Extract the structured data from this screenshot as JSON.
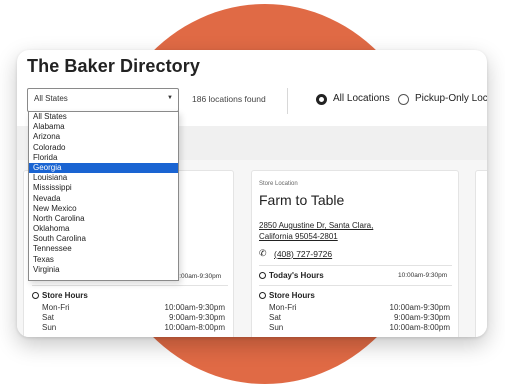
{
  "page_title": "The Baker Directory",
  "state_select": {
    "value": "All States",
    "options": [
      "All States",
      "Alabama",
      "Arizona",
      "Colorado",
      "Florida",
      "Georgia",
      "Louisiana",
      "Mississippi",
      "Nevada",
      "New Mexico",
      "North Carolina",
      "Oklahoma",
      "South Carolina",
      "Tennessee",
      "Texas",
      "Virginia"
    ],
    "highlighted": "Georgia"
  },
  "locations_found": "186 locations found",
  "filter": {
    "all_label": "All Locations",
    "pickup_label": "Pickup-Only Loca",
    "selected": "All Locations"
  },
  "stores": [
    {
      "todays_hours_value": "10:00am-9:30pm",
      "hours": [
        {
          "day": "Mon-Fri",
          "time": "10:00am-9:30pm"
        },
        {
          "day": "Sat",
          "time": "9:00am-9:30pm"
        },
        {
          "day": "Sun",
          "time": "10:00am-8:00pm"
        }
      ]
    },
    {
      "label": "Store Location",
      "name": "Farm to Table",
      "address_line1": "2850 Augustine Dr, Santa Clara,",
      "address_line2": "California 95054-2801",
      "phone": "(408) 727-9726",
      "todays_hours_label": "Today's Hours",
      "todays_hours_value": "10:00am-9:30pm",
      "hours": [
        {
          "day": "Mon-Fri",
          "time": "10:00am-9:30pm"
        },
        {
          "day": "Sat",
          "time": "9:00am-9:30pm"
        },
        {
          "day": "Sun",
          "time": "10:00am-8:00pm"
        }
      ]
    }
  ],
  "store_hours_label": "Store Hours",
  "icons": {
    "select_arrow": "chevron-down-icon",
    "clock": "clock-icon",
    "phone": "phone-icon"
  },
  "colors": {
    "accent_circle": "#e06a45",
    "selection_blue": "#1a64d2"
  }
}
